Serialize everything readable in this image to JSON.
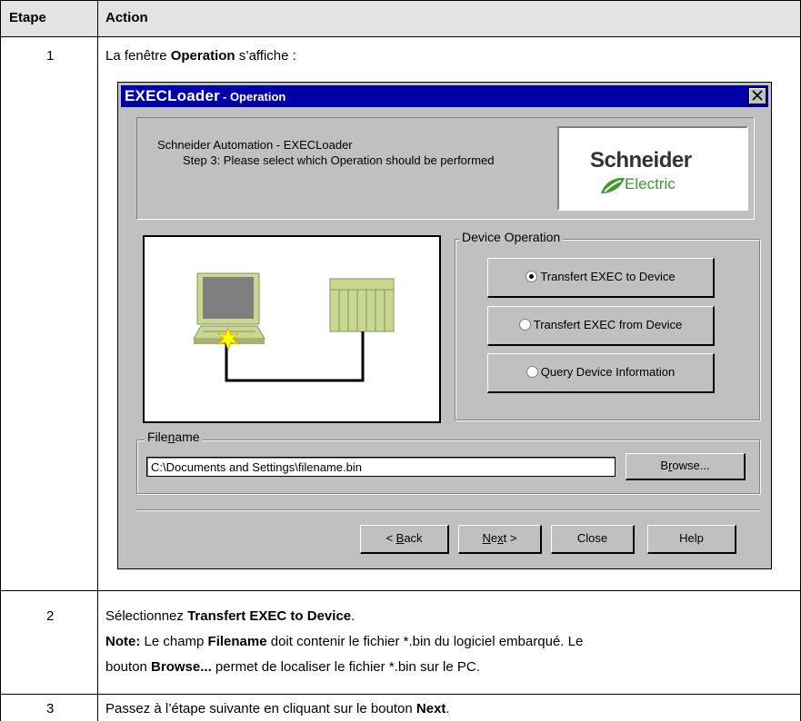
{
  "table": {
    "headers": {
      "step": "Etape",
      "action": "Action"
    },
    "rows": [
      {
        "step": "1",
        "text_before": "La fenêtre ",
        "text_bold": "Operation",
        "text_after": " s’affiche :"
      },
      {
        "step": "2",
        "line1_before": "Sélectionnez ",
        "line1_bold": "Transfert EXEC to Device",
        "line1_after": ".",
        "note_label": "Note:",
        "note_before": " Le champ ",
        "note_bold1": "Filename",
        "note_mid": " doit contenir le fichier *.bin du logiciel embarqué. Le",
        "note2_before": "bouton ",
        "note2_bold": "Browse...",
        "note2_after": " permet de localiser le fichier *.bin sur le PC."
      },
      {
        "step": "3",
        "text_before": "Passez à l’étape suivante en cliquant sur le bouton ",
        "text_bold": "Next",
        "text_after": "."
      }
    ]
  },
  "dialog": {
    "title_main": "EXECLoader",
    "title_sub": " - Operation",
    "header_line1": "Schneider Automation - EXECLoader",
    "header_line2": "Step 3: Please select which Operation should be performed",
    "logo_word": "Schneider",
    "logo_sub": "Electric",
    "device_group_label": "Device Operation",
    "options": [
      {
        "label": "Transfert EXEC to Device",
        "selected": true
      },
      {
        "label": "Transfert EXEC from Device",
        "selected": false
      },
      {
        "label": "Query Device Information",
        "selected": false
      }
    ],
    "filename_label_pre": "File",
    "filename_label_u": "n",
    "filename_label_post": "ame",
    "filename_value": "C:\\Documents and Settings\\filename.bin",
    "browse_pre": "B",
    "browse_u": "r",
    "browse_post": "owse...",
    "back_pre": "< ",
    "back_u": "B",
    "back_post": "ack",
    "next_pre": "N",
    "next_u": "e",
    "next_u2": "x",
    "next_post": "t >",
    "close_label": "Close",
    "help_label": "Help"
  },
  "colors": {
    "window_bg": "#c0c0c0",
    "titlebar": "#0000a8",
    "logo_green": "#3a9a28",
    "pc_body": "#c8d890",
    "pc_screen": "#7f7f7f",
    "plc_body": "#c8d890",
    "spark": "#ffff00"
  }
}
